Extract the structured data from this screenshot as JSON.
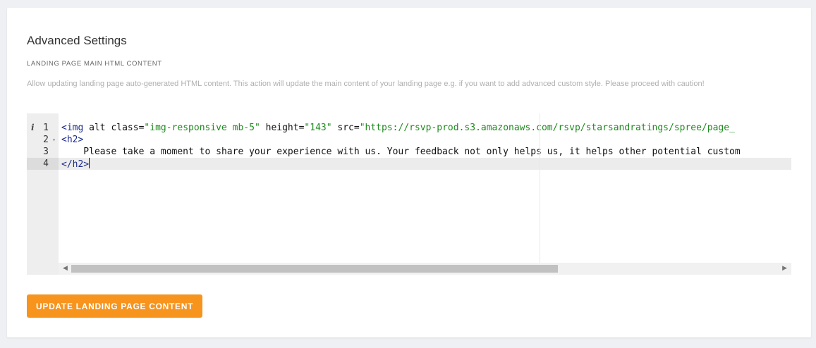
{
  "settings": {
    "title": "Advanced Settings",
    "section_label": "LANDING PAGE MAIN HTML CONTENT",
    "description": "Allow updating landing page auto-generated HTML content. This action will update the main content of your landing page e.g. if you want to add advanced custom style. Please proceed with caution!"
  },
  "editor": {
    "line_numbers": [
      "1",
      "2",
      "3",
      "4"
    ],
    "line1": {
      "tag_open": "<img",
      "alt": " alt",
      "class_attr": " class=",
      "class_val": "\"img-responsive mb-5\"",
      "height_attr": " height=",
      "height_val": "\"143\"",
      "src_attr": " src=",
      "src_val": "\"https://rsvp-prod.s3.amazonaws.com/rsvp/starsandratings/spree/page_"
    },
    "line2": "<h2>",
    "line3": "    Please take a moment to share your experience with us. Your feedback not only helps us, it helps other potential custom",
    "line4": "</h2>",
    "info_icon": "info-icon",
    "fold_icon": "fold-arrow-icon"
  },
  "actions": {
    "update_label": "UPDATE LANDING PAGE CONTENT"
  },
  "colors": {
    "accent": "#f7941d",
    "tag": "#1c2a8a",
    "string": "#1f8a1f"
  }
}
